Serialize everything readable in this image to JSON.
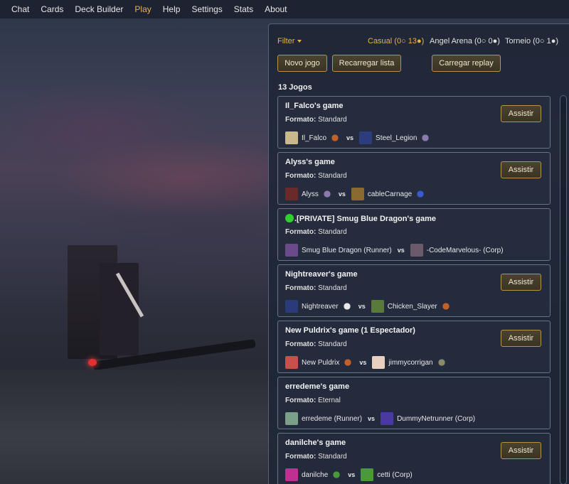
{
  "nav": {
    "items": [
      {
        "label": "Chat",
        "active": false
      },
      {
        "label": "Cards",
        "active": false
      },
      {
        "label": "Deck Builder",
        "active": false
      },
      {
        "label": "Play",
        "active": true
      },
      {
        "label": "Help",
        "active": false
      },
      {
        "label": "Settings",
        "active": false
      },
      {
        "label": "Stats",
        "active": false
      },
      {
        "label": "About",
        "active": false
      }
    ]
  },
  "panel": {
    "filter_label": "Filter",
    "modes": {
      "casual": "Casual (0○ 13●)",
      "angel": "Angel Arena (0○ 0●)",
      "torneio": "Torneio (0○ 1●)"
    },
    "buttons": {
      "new_game": "Novo jogo",
      "reload": "Recarregar lista",
      "replay": "Carregar replay"
    },
    "count": "13 Jogos",
    "format_label": "Formato:",
    "vs": "vs",
    "watch_label": "Assistir"
  },
  "games": [
    {
      "title": "Il_Falco's game",
      "format": "Standard",
      "p1": "Il_Falco",
      "p2": "Steel_Legion",
      "watch": true,
      "private": false
    },
    {
      "title": "Alyss's game",
      "format": "Standard",
      "p1": "Alyss",
      "p2": "cableCarnage",
      "watch": true,
      "private": false
    },
    {
      "title": ".[PRIVATE] Smug Blue Dragon's game",
      "format": "Standard",
      "p1": "Smug Blue Dragon (Runner)",
      "p2": "-CodeMarvelous- (Corp)",
      "watch": false,
      "private": true
    },
    {
      "title": "Nightreaver's game",
      "format": "Standard",
      "p1": "Nightreaver",
      "p2": "Chicken_Slayer",
      "watch": true,
      "private": false
    },
    {
      "title": "New Puldrix's game (1 Espectador)",
      "format": "Standard",
      "p1": "New Puldrix",
      "p2": "jimmycorrigan",
      "watch": true,
      "private": false
    },
    {
      "title": "erredeme's game",
      "format": "Eternal",
      "p1": "erredeme (Runner)",
      "p2": "DummyNetrunner (Corp)",
      "watch": false,
      "private": false
    },
    {
      "title": "danilche's game",
      "format": "Standard",
      "p1": "danilche",
      "p2": "cetti (Corp)",
      "watch": true,
      "private": false
    }
  ],
  "colors": {
    "accent": "#e9b24a",
    "panel_bg": "#1e2636",
    "button_border": "#b79447",
    "private_dot": "#2ed12e"
  }
}
